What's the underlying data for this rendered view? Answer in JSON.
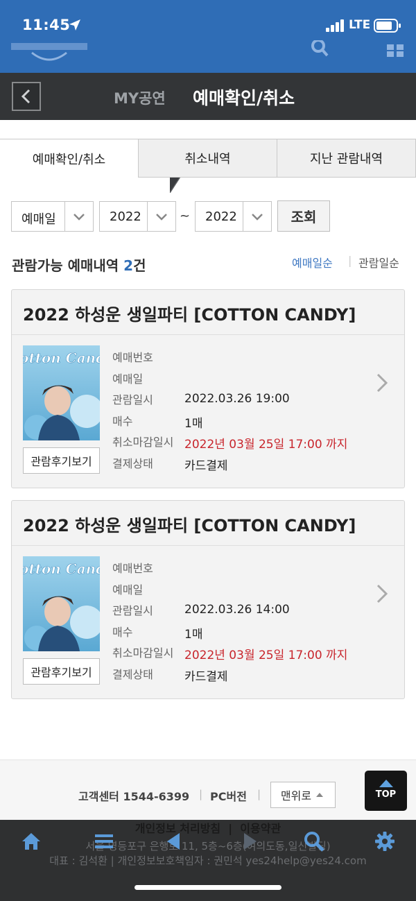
{
  "status_bar": {
    "time": "11:45",
    "network": "LTE"
  },
  "header": {
    "back_label": "back",
    "parent": "MY공연",
    "current": "예매확인/취소"
  },
  "tabs": [
    {
      "label": "예매확인/취소",
      "active": true
    },
    {
      "label": "취소내역",
      "active": false
    },
    {
      "label": "지난 관람내역",
      "active": false
    }
  ],
  "filters": {
    "date_type": "예매일",
    "year_from": "2022",
    "separator": "~",
    "year_to": "2022",
    "search_label": "조회"
  },
  "list": {
    "title_prefix": "관람가능 예매내역 ",
    "count": "2",
    "title_suffix": "건",
    "sort_booking": "예매일순",
    "sort_separator": "|",
    "sort_viewing": "관람일순"
  },
  "field_labels": {
    "booking_no": "예매번호",
    "booking_date": "예매일",
    "viewing_date": "관람일시",
    "quantity": "매수",
    "cancel_deadline": "취소마감일시",
    "payment_status": "결제상태"
  },
  "bookings": [
    {
      "title": "2022 하성운 생일파티 [COTTON CANDY]",
      "poster_text": "Cotton Candy",
      "booking_no": "",
      "booking_date": "",
      "viewing_datetime": "2022.03.26 19:00",
      "quantity": "1매",
      "cancel_deadline": "2022년 03월 25일 17:00 까지",
      "payment_status": "카드결제",
      "review_label": "관람후기보기"
    },
    {
      "title": "2022 하성운 생일파티 [COTTON CANDY]",
      "poster_text": "Cotton Candy",
      "booking_no": "",
      "booking_date": "",
      "viewing_datetime": "2022.03.26 14:00",
      "quantity": "1매",
      "cancel_deadline": "2022년 03월 25일 17:00 까지",
      "payment_status": "카드결제",
      "review_label": "관람후기보기"
    }
  ],
  "footer": {
    "customer_center": "고객센터 1544-6399",
    "pc_version": "PC버전",
    "separator": "|",
    "to_top": "맨위로",
    "top_fab": "TOP",
    "privacy": "개인정보 처리방침",
    "terms": "이용약관",
    "address_partial": "서울 영등포구 은행로 11, 5층~6층(여의도동,일신빌딩)",
    "ceo_partial": "대표 : 김석환 | 개인정보보호책임자 : 권민석 yes24help@yes24.com"
  },
  "nav": [
    "home-icon",
    "menu-icon",
    "back-arrow-icon",
    "forward-arrow-icon",
    "search-icon",
    "settings-icon"
  ],
  "colors": {
    "header_blue": "#2f6db6",
    "accent_red": "#c8252c",
    "sort_blue": "#3f78c2",
    "nav_dark": "#2f3031"
  }
}
